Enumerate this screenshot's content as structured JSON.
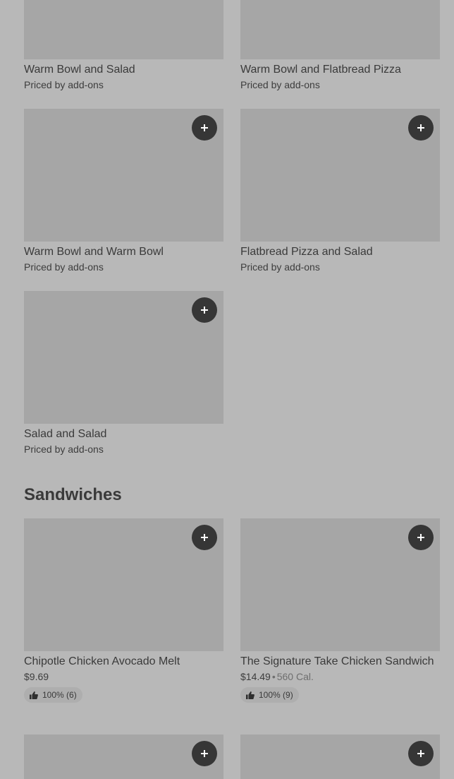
{
  "combos": [
    {
      "name": "Warm Bowl and Salad",
      "price": "Priced by add-ons"
    },
    {
      "name": "Warm Bowl and Flatbread Pizza",
      "price": "Priced by add-ons"
    },
    {
      "name": "Warm Bowl and Warm Bowl",
      "price": "Priced by add-ons"
    },
    {
      "name": "Flatbread Pizza and Salad",
      "price": "Priced by add-ons"
    },
    {
      "name": "Salad and Salad",
      "price": "Priced by add-ons"
    }
  ],
  "sandwiches": {
    "title": "Sandwiches",
    "items": [
      {
        "name": "Chipotle Chicken Avocado Melt",
        "price": "$9.69",
        "calories": "",
        "rating": "100% (6)"
      },
      {
        "name": "The Signature Take Chicken Sandwich",
        "price": "$14.49",
        "calories": "560 Cal.",
        "rating": "100% (9)"
      }
    ]
  },
  "colors": {
    "background": "#b8b8b8",
    "image_placeholder": "#a6a6a6",
    "add_button": "#363636"
  },
  "icons": {
    "add": "plus-icon",
    "rating": "thumbs-up-icon"
  }
}
